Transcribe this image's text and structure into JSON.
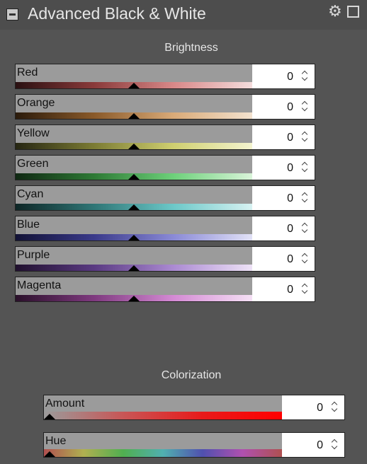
{
  "panel": {
    "title": "Advanced Black & White",
    "icons": {
      "collapse": "collapse-box-icon",
      "settings": "gear-icon",
      "toggle": "checkbox-icon"
    }
  },
  "brightness": {
    "heading": "Brightness",
    "sliders": [
      {
        "label": "Red",
        "value": "0",
        "level": 0.5,
        "gradient": [
          "#2a1011",
          "#8a3a3a",
          "#d88888",
          "#f4dcdc"
        ]
      },
      {
        "label": "Orange",
        "value": "0",
        "level": 0.5,
        "gradient": [
          "#2b1b0b",
          "#8a5a2a",
          "#d9aa78",
          "#f3e2cf"
        ]
      },
      {
        "label": "Yellow",
        "value": "0",
        "level": 0.5,
        "gradient": [
          "#262612",
          "#7c7c34",
          "#cfcf70",
          "#f4f4cf"
        ]
      },
      {
        "label": "Green",
        "value": "0",
        "level": 0.5,
        "gradient": [
          "#0f2812",
          "#2e7a35",
          "#6dd07a",
          "#d9f4d9"
        ]
      },
      {
        "label": "Cyan",
        "value": "0",
        "level": 0.5,
        "gradient": [
          "#0d2626",
          "#2f7676",
          "#6cc8c8",
          "#d7f2f2"
        ]
      },
      {
        "label": "Blue",
        "value": "0",
        "level": 0.5,
        "gradient": [
          "#121236",
          "#3a3a8a",
          "#8a8ad6",
          "#e1e1f6"
        ]
      },
      {
        "label": "Purple",
        "value": "0",
        "level": 0.5,
        "gradient": [
          "#20102e",
          "#5a3a82",
          "#ab8ad2",
          "#eee2f7"
        ]
      },
      {
        "label": "Magenta",
        "value": "0",
        "level": 0.5,
        "gradient": [
          "#2a102a",
          "#7f3a7f",
          "#d48ad4",
          "#f5e0f5"
        ]
      }
    ]
  },
  "colorization": {
    "heading": "Colorization",
    "sliders": [
      {
        "label": "Amount",
        "value": "0",
        "level": 0.0,
        "gradient": [
          "#9b9b9b",
          "#c85656",
          "#e81a1a",
          "#ff0000"
        ]
      },
      {
        "label": "Hue",
        "value": "0",
        "level": 0.0,
        "gradient": [
          "#b05050",
          "#b0b050",
          "#50b050",
          "#50b0b0",
          "#5050b0",
          "#b050b0",
          "#b05050"
        ]
      }
    ]
  }
}
